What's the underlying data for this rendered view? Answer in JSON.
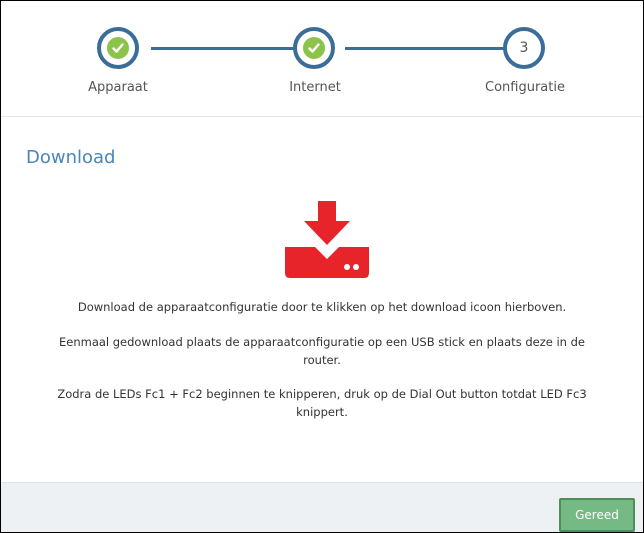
{
  "wizard": {
    "steps": [
      {
        "label": "Apparaat",
        "state": "done",
        "icon": "check-icon"
      },
      {
        "label": "Internet",
        "state": "done",
        "icon": "check-icon"
      },
      {
        "label": "Configuratie",
        "state": "current",
        "number": "3"
      }
    ]
  },
  "main": {
    "title": "Download",
    "download_icon": "download-router-icon",
    "messages": [
      "Download de apparaatconfiguratie door te klikken op het download icoon hierboven.",
      "Eenmaal gedownload plaats de apparaatconfiguratie op een USB stick en plaats deze in de router.",
      "Zodra de LEDs Fc1 + Fc2 beginnen te knipperen, druk op de Dial Out button totdat LED Fc3 knippert."
    ]
  },
  "footer": {
    "done_label": "Gereed"
  },
  "colors": {
    "accent": "#3a6e99",
    "check": "#8cc34a",
    "title": "#4a86b8",
    "download": "#e8242b",
    "button": "#75b984"
  }
}
